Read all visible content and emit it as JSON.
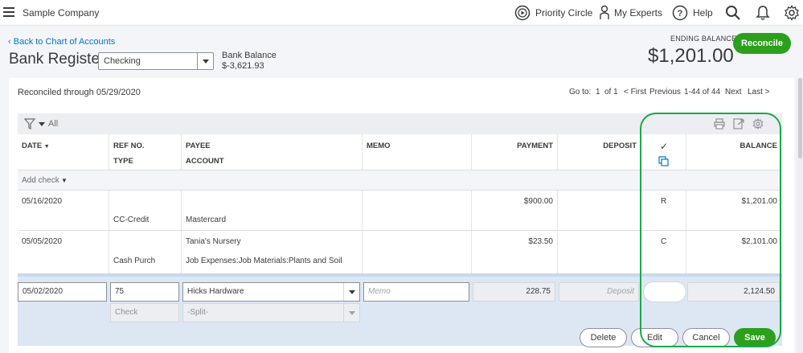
{
  "topbar": {
    "company": "Sample Company",
    "priority_circle": "Priority Circle",
    "my_experts": "My Experts",
    "help": "Help"
  },
  "header": {
    "back_link": "Back to Chart of Accounts",
    "title": "Bank Register",
    "account": "Checking",
    "bank_balance_label": "Bank Balance",
    "bank_balance_value": "$-3,621.93",
    "ending_balance_label": "ENDING BALANCE",
    "ending_balance_value": "$1,201.00",
    "reconcile_label": "Reconcile"
  },
  "register": {
    "reconciled_through": "Reconciled through 05/29/2020",
    "pager": {
      "goto": "Go to:",
      "page": "1",
      "of": "of 1",
      "first": "< First",
      "previous": "Previous",
      "range": "1-44 of 44",
      "next": "Next",
      "last": "Last >"
    },
    "filter_label": "All",
    "columns": {
      "date": "DATE",
      "ref_no": "REF NO.",
      "type": "TYPE",
      "payee": "PAYEE",
      "account": "ACCOUNT",
      "memo": "MEMO",
      "payment": "PAYMENT",
      "deposit": "DEPOSIT",
      "check": "✓",
      "balance": "BALANCE"
    },
    "add_check": "Add check",
    "rows": [
      {
        "date": "05/16/2020",
        "ref": "",
        "type": "CC-Credit",
        "payee": "",
        "account": "Mastercard",
        "memo": "",
        "payment": "$900.00",
        "deposit": "",
        "status": "R",
        "balance": "$1,201.00"
      },
      {
        "date": "05/05/2020",
        "ref": "",
        "type": "Cash Purch",
        "payee": "Tania's Nursery",
        "account": "Job Expenses:Job Materials:Plants and Soil",
        "memo": "",
        "payment": "$23.50",
        "deposit": "",
        "status": "C",
        "balance": "$2,101.00"
      }
    ],
    "edit_row": {
      "date": "05/02/2020",
      "ref": "75",
      "type": "Check",
      "payee": "Hicks Hardware",
      "account": "-Split-",
      "memo_placeholder": "Memo",
      "payment": "228.75",
      "deposit_placeholder": "Deposit",
      "balance": "2,124.50"
    },
    "buttons": {
      "delete": "Delete",
      "edit": "Edit",
      "cancel": "Cancel",
      "save": "Save"
    }
  },
  "colors": {
    "accent_green": "#2ca01c",
    "link_blue": "#0077c5",
    "highlight_green": "#1ba84a"
  }
}
